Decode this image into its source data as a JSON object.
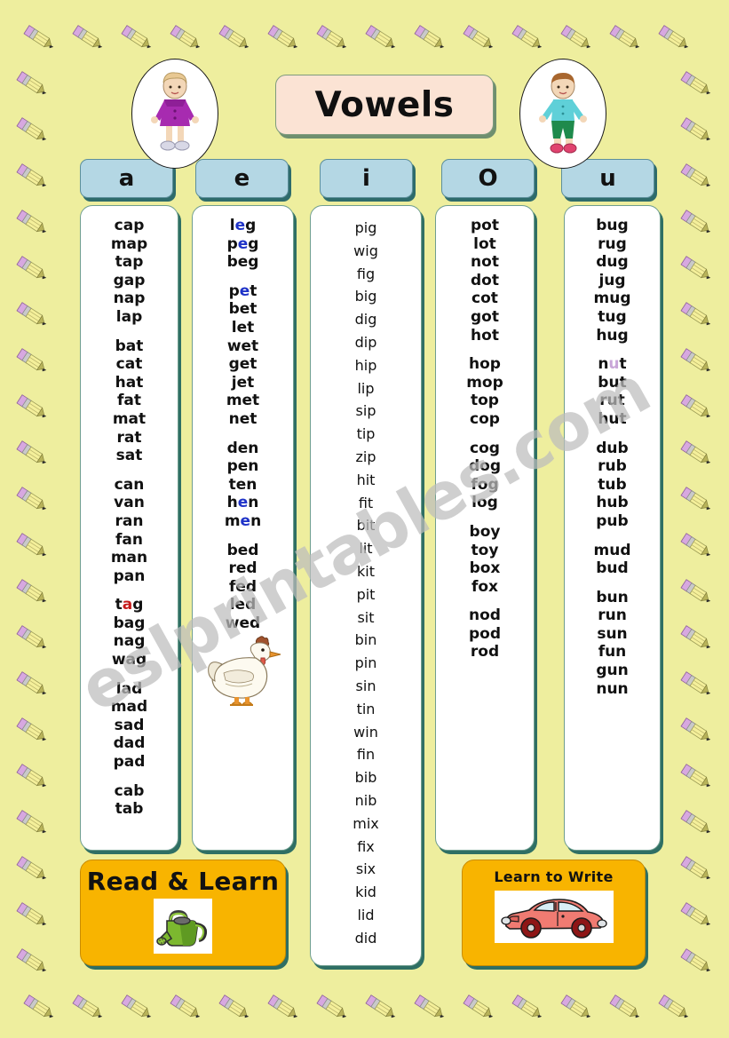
{
  "page": {
    "title": "Vowels",
    "background_color": "#eeee9e",
    "watermark": "eslprintables.com"
  },
  "header": {
    "title": "Vowels",
    "title_bg": "#fbe3d4",
    "left_image": "girl-doll-image",
    "right_image": "boy-doll-image"
  },
  "tabs": [
    {
      "label": "a",
      "name": "tab-vowel-a"
    },
    {
      "label": "e",
      "name": "tab-vowel-e"
    },
    {
      "label": "i",
      "name": "tab-vowel-i"
    },
    {
      "label": "O",
      "name": "tab-vowel-o"
    },
    {
      "label": "u",
      "name": "tab-vowel-u"
    }
  ],
  "tab_color": "#b4d7e4",
  "columns": {
    "a": {
      "vowel": "a",
      "style": "bold",
      "groups": [
        [
          "cap",
          "map",
          "tap",
          "gap",
          "nap",
          "lap"
        ],
        [
          "bat",
          "cat",
          "hat",
          "fat",
          "mat",
          "rat",
          "sat"
        ],
        [
          "can",
          "van",
          "ran",
          "fan",
          "man",
          "pan"
        ],
        [
          "tag",
          "bag",
          "nag",
          "wag"
        ],
        [
          "lad",
          "mad",
          "sad",
          "dad",
          "pad"
        ],
        [
          "cab",
          "tab"
        ]
      ],
      "highlight": {
        "word": "tag",
        "letter": "a",
        "color": "#c41a1a"
      }
    },
    "e": {
      "vowel": "e",
      "style": "bold",
      "groups": [
        [
          "leg",
          "peg",
          "beg"
        ],
        [
          "pet",
          "bet",
          "let",
          "wet",
          "get",
          "jet",
          "met",
          "net"
        ],
        [
          "den",
          "pen",
          "ten",
          "hen",
          "men"
        ],
        [
          "bed",
          "red",
          "fed",
          "led",
          "wed"
        ]
      ],
      "highlight_color": "#1f33c8",
      "highlighted_words": [
        "leg",
        "peg",
        "pet",
        "hen",
        "men"
      ],
      "image": "hen-image"
    },
    "i": {
      "vowel": "i",
      "style": "light",
      "groups": [
        [
          "pig",
          "wig",
          "fig",
          "big",
          "dig",
          "dip",
          "hip",
          "lip",
          "sip",
          "tip",
          "zip",
          "hit",
          "fit",
          "bit",
          "lit",
          "kit",
          "pit",
          "sit",
          "bin",
          "pin",
          "sin",
          "tin",
          "win",
          "fin",
          "bib",
          "nib",
          "mix",
          "fix",
          "six",
          "kid",
          "lid",
          "did"
        ]
      ],
      "image": "pig-image"
    },
    "o": {
      "vowel": "O",
      "style": "bold",
      "groups": [
        [
          "pot",
          "lot",
          "not",
          "dot",
          "cot",
          "got",
          "hot"
        ],
        [
          "hop",
          "mop",
          "top",
          "cop"
        ],
        [
          "cog",
          "dog",
          "fog",
          "log"
        ],
        [
          "boy",
          "toy",
          "box",
          "fox"
        ],
        [
          "nod",
          "pod",
          "rod"
        ]
      ]
    },
    "u": {
      "vowel": "u",
      "style": "bold",
      "groups": [
        [
          "bug",
          "rug",
          "dug",
          "jug",
          "mug",
          "tug",
          "hug"
        ],
        [
          "nut",
          "but",
          "rut",
          "hut"
        ],
        [
          "dub",
          "rub",
          "tub",
          "hub",
          "pub"
        ],
        [
          "mud",
          "bud"
        ],
        [
          "bun",
          "run",
          "sun",
          "fun",
          "gun",
          "nun"
        ]
      ],
      "highlight": {
        "word": "nut",
        "letter": "u",
        "color": "#c9a6d8"
      }
    }
  },
  "banners": {
    "read_learn": {
      "label": "Read & Learn",
      "bg_color": "#f8b400",
      "image": "watering-can-image"
    },
    "learn_write": {
      "label": "Learn   to Write",
      "bg_color": "#f8b400",
      "image": "red-car-image"
    }
  }
}
